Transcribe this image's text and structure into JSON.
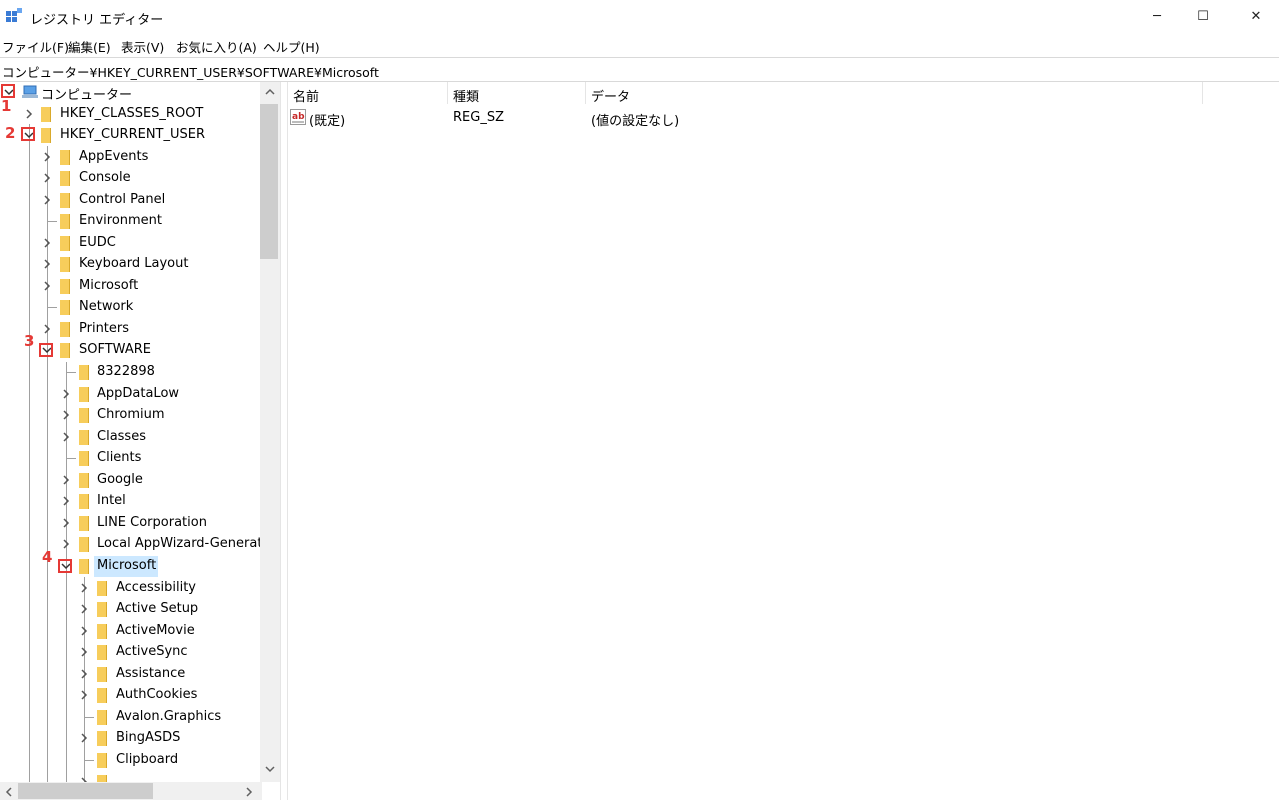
{
  "window": {
    "title": "レジストリ エディター",
    "controls": {
      "minimize": "─",
      "maximize": "☐",
      "close": "✕"
    }
  },
  "menu": [
    "ファイル(F)",
    "編集(E)",
    "表示(V)",
    "お気に入り(A)",
    "ヘルプ(H)"
  ],
  "address": "コンピューター¥HKEY_CURRENT_USER¥SOFTWARE¥Microsoft",
  "tree": {
    "root": "コンピューター",
    "hkcr": "HKEY_CLASSES_ROOT",
    "hkcu": "HKEY_CURRENT_USER",
    "hkcu_children": [
      "AppEvents",
      "Console",
      "Control Panel",
      "Environment",
      "EUDC",
      "Keyboard Layout",
      "Microsoft",
      "Network",
      "Printers",
      "SOFTWARE"
    ],
    "software_children": [
      "8322898",
      "AppDataLow",
      "Chromium",
      "Classes",
      "Clients",
      "Google",
      "Intel",
      "LINE Corporation",
      "Local AppWizard-Generate",
      "Microsoft"
    ],
    "microsoft_children": [
      "Accessibility",
      "Active Setup",
      "ActiveMovie",
      "ActiveSync",
      "Assistance",
      "AuthCookies",
      "Avalon.Graphics",
      "BingASDS",
      "Clipboard"
    ],
    "selected": "Microsoft"
  },
  "markers": [
    "1",
    "2",
    "3",
    "4"
  ],
  "list": {
    "headers": {
      "name": "名前",
      "type": "種類",
      "data": "データ"
    },
    "rows": [
      {
        "name": "(既定)",
        "type": "REG_SZ",
        "data": "(値の設定なし)"
      }
    ]
  },
  "colors": {
    "selection": "#cce8ff",
    "folder": "#f7cd5b",
    "marker": "#e53935"
  }
}
